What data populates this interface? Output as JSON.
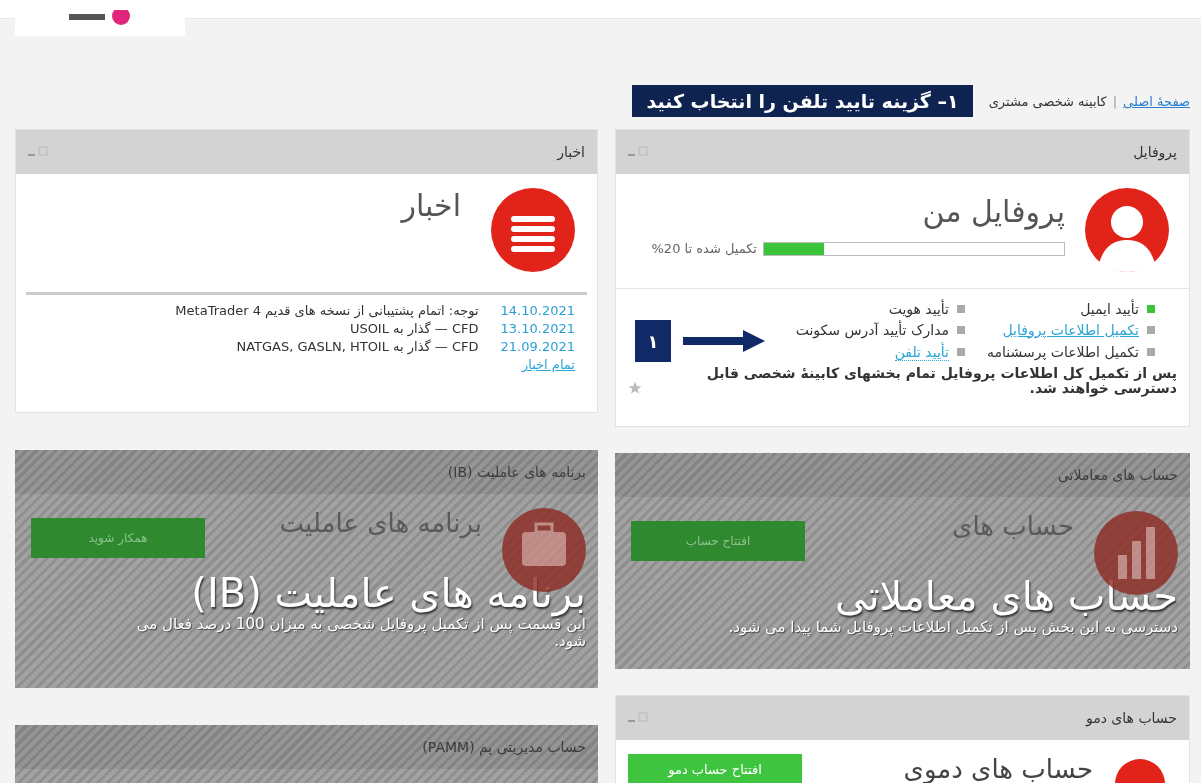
{
  "breadcrumb": {
    "items": [
      {
        "label": "صفحهٔ اصلی",
        "link": true
      },
      {
        "label": "کابینه شخصی مشتری",
        "link": false
      }
    ],
    "separator": "|"
  },
  "callout": "۱– گزینه تایید تلفن را انتخاب کنید",
  "columns": [
    [
      {
        "kind": "profile",
        "title": "پروفایل",
        "heading": "پروفایل من",
        "progress": {
          "level": 0.2,
          "label": "تکمیل شده تا 20%"
        },
        "checklist": [
          {
            "label": "تأیید ایمیل",
            "done": true,
            "kind": "text"
          },
          {
            "label": "تأیید هویت",
            "done": false,
            "kind": "text"
          },
          {
            "label": "تکمیل اطلاعات پروفایل",
            "done": false,
            "kind": "link"
          },
          {
            "label": "مدارک تأیید آدرس سکونت",
            "done": false,
            "kind": "text"
          },
          {
            "label": "تکمیل اطلاعات پرسشنامه",
            "done": false,
            "kind": "text"
          },
          {
            "label": "تأیید تلفن",
            "done": false,
            "kind": "dotted_link"
          }
        ],
        "step_marker": "۱",
        "note": "پس از تکمیل کل اطلاعات پروفایل تمام بخشهای کابینهٔ شخصی قابل دسترسی خواهند شد."
      },
      {
        "kind": "locked",
        "title": "حساب های معاملاتی",
        "faded_heading": "حساب های",
        "button": "افتتاح حساب",
        "overlay_title": "حساب های معاملاتی",
        "description": "دسترسی به این بخش پس از تکمیل اطلاعات پروفایل شما پیدا می شود."
      },
      {
        "kind": "demo",
        "title": "حساب های دمو",
        "heading": "حساب های دموی",
        "button": "افتتاح حساب دمو"
      }
    ],
    [
      {
        "kind": "news",
        "title": "اخبار",
        "heading": "اخبار",
        "items": [
          {
            "date": "14.10.2021",
            "text": "توجه: اتمام پشتیبانی از نسخه های قدیم MetaTrader 4"
          },
          {
            "date": "13.10.2021",
            "text": "CFD — گذار به USOIL"
          },
          {
            "date": "21.09.2021",
            "text": "CFD — گذار به NATGAS, GASLN, HTOIL"
          }
        ],
        "all_link": "تمام اخبار"
      },
      {
        "kind": "locked",
        "title": "برنامه های عاملیت (IB)",
        "faded_heading": "برنامه های عاملیت",
        "button": "همکار شوید",
        "overlay_title": "برنامه های عاملیت (IB)",
        "description": "این قسمت پس از تکمیل پروفایل شخصی به میزان 100 درصد فعال می شود."
      },
      {
        "kind": "locked_header",
        "title": "حساب مدیریتی پم (PAMM)"
      }
    ]
  ]
}
